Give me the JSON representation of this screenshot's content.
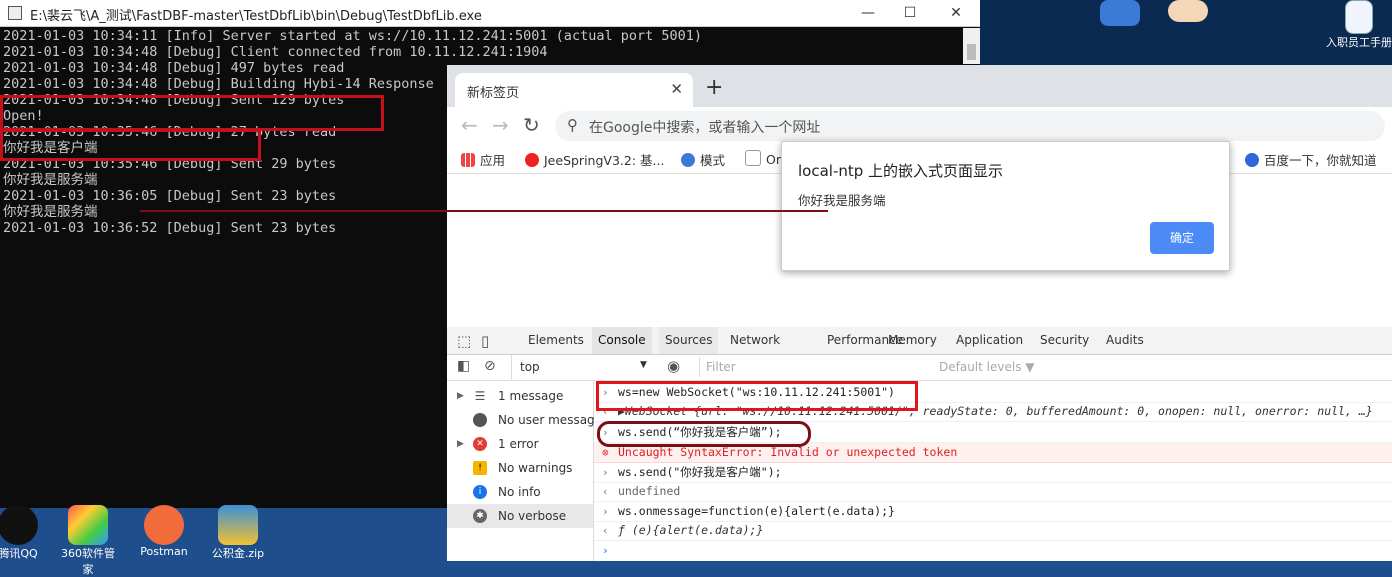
{
  "console_window": {
    "title": "E:\\裴云飞\\A_测试\\FastDBF-master\\TestDbfLib\\bin\\Debug\\TestDbfLib.exe",
    "lines": [
      "2021-01-03 10:34:11 [Info] Server started at ws://10.11.12.241:5001 (actual port 5001)",
      "2021-01-03 10:34:48 [Debug] Client connected from 10.11.12.241:1904",
      "2021-01-03 10:34:48 [Debug] 497 bytes read",
      "2021-01-03 10:34:48 [Debug] Building Hybi-14 Response",
      "2021-01-03 10:34:48 [Debug] Sent 129 bytes",
      "Open!",
      "2021-01-03 10:35:46 [Debug] 27 bytes read",
      "你好我是客户端",
      "2021-01-03 10:35:46 [Debug] Sent 29 bytes",
      "你好我是服务端",
      "2021-01-03 10:36:05 [Debug] Sent 23 bytes",
      "你好我是服务端",
      "2021-01-03 10:36:52 [Debug] Sent 23 bytes"
    ]
  },
  "desktop": {
    "top_right_label": "入职员工手册",
    "taskbar_labels": [
      "腾讯QQ",
      "360软件管家",
      "Postman",
      "公积金.zip"
    ]
  },
  "browser": {
    "tab_title": "新标签页",
    "omnibox_placeholder": "在Google中搜索，或者输入一个网址",
    "bookmarks": [
      "应用",
      "JeeSpringV3.2: 基...",
      "模式",
      "Or",
      "百度一下，你就知道"
    ]
  },
  "alert": {
    "title": "local-ntp 上的嵌入式页面显示",
    "message": "你好我是服务端",
    "ok_label": "确定"
  },
  "devtools": {
    "tabs": [
      "Elements",
      "Console",
      "Sources",
      "Network",
      "Performance",
      "Memory",
      "Application",
      "Security",
      "Audits"
    ],
    "context": "top",
    "filter_placeholder": "Filter",
    "levels": "Default levels ▼",
    "sidebar": [
      {
        "label": "1 message",
        "expandable": true
      },
      {
        "label": "No user messag...",
        "expandable": false
      },
      {
        "label": "1 error",
        "expandable": true
      },
      {
        "label": "No warnings",
        "expandable": false
      },
      {
        "label": "No info",
        "expandable": false
      },
      {
        "label": "No verbose",
        "expandable": false
      }
    ],
    "log": [
      {
        "kind": "input",
        "text": "ws=new WebSocket(\"ws:10.11.12.241:5001\")"
      },
      {
        "kind": "output",
        "text": "▶WebSocket {url: \"ws://10.11.12.241:5001/\", readyState: 0, bufferedAmount: 0, onopen: null, onerror: null, …}"
      },
      {
        "kind": "input",
        "text": "ws.send(“你好我是客户端”);"
      },
      {
        "kind": "error",
        "text": "Uncaught SyntaxError: Invalid or unexpected token"
      },
      {
        "kind": "input",
        "text": "ws.send(\"你好我是客户端\");"
      },
      {
        "kind": "output",
        "text": "undefined"
      },
      {
        "kind": "input",
        "text": "ws.onmessage=function(e){alert(e.data);}"
      },
      {
        "kind": "output",
        "text": "ƒ (e){alert(e.data);}"
      }
    ]
  },
  "colors": {
    "annotation_red": "#e0151d",
    "annotation_darkred": "#7a0f1a",
    "chrome_blue": "#4c8bf5"
  }
}
